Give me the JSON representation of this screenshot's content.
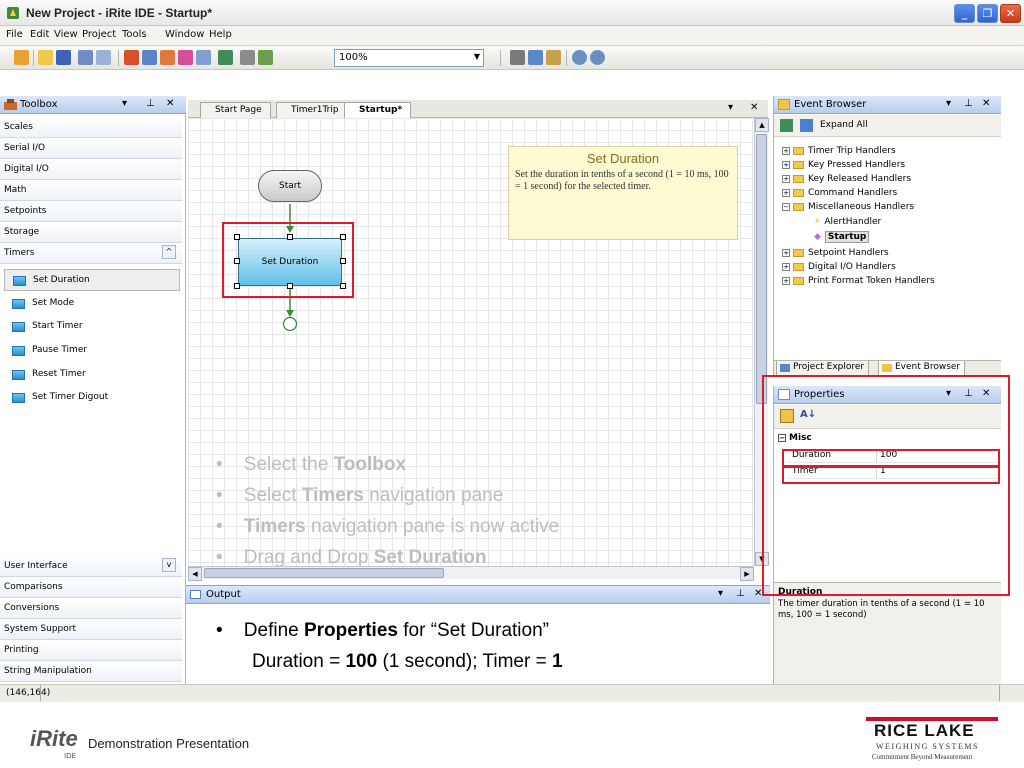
{
  "window": {
    "title": "New Project - iRite IDE - Startup*"
  },
  "menu": [
    "File",
    "Edit",
    "View",
    "Project",
    "Tools",
    "Window",
    "Help"
  ],
  "toolbar": {
    "zoom": "100%"
  },
  "toolbox": {
    "title": "Toolbox",
    "categories_top": [
      "Scales",
      "Serial I/O",
      "Digital I/O",
      "Math",
      "Setpoints",
      "Storage"
    ],
    "active_category": "Timers",
    "items": [
      "Set Duration",
      "Set Mode",
      "Start Timer",
      "Pause Timer",
      "Reset Timer",
      "Set Timer Digout"
    ],
    "categories_bottom": [
      "User Interface",
      "Comparisons",
      "Conversions",
      "System Support",
      "Printing",
      "String Manipulation"
    ]
  },
  "doc_tabs": [
    "Start Page",
    "Timer1Trip",
    "Startup*"
  ],
  "canvas": {
    "start_node": "Start",
    "selected_node": "Set Duration",
    "tooltip_title": "Set Duration",
    "tooltip_body": "Set the duration in tenths of a second (1 = 10 ms, 100 = 1 second) for the selected timer."
  },
  "overlay_bullets": [
    {
      "pre": "Select the ",
      "bold": "Toolbox",
      "post": ""
    },
    {
      "pre": "Select ",
      "bold": "Timers",
      "post": " navigation pane"
    },
    {
      "pre": "",
      "bold": "Timers",
      "post": " navigation pane is now active"
    },
    {
      "pre": "Drag and Drop ",
      "bold": "Set Duration",
      "post": ""
    }
  ],
  "output": {
    "title": "Output",
    "line1_pre": "Define ",
    "line1_bold": "Properties",
    "line1_post": " for “Set Duration”",
    "line2_pre": "Duration = ",
    "line2_bold1": "100",
    "line2_mid": " (1 second);  Timer = ",
    "line2_bold2": "1"
  },
  "event_browser": {
    "title": "Event Browser",
    "expand_all": "Expand All",
    "tree": [
      {
        "label": "Timer Trip Handlers",
        "level": 0,
        "type": "folder",
        "state": "+"
      },
      {
        "label": "Key Pressed Handlers",
        "level": 0,
        "type": "folder",
        "state": "+"
      },
      {
        "label": "Key Released Handlers",
        "level": 0,
        "type": "folder",
        "state": "+"
      },
      {
        "label": "Command Handlers",
        "level": 0,
        "type": "folder",
        "state": "+"
      },
      {
        "label": "Miscellaneous Handlers",
        "level": 0,
        "type": "folder",
        "state": "-"
      },
      {
        "label": "AlertHandler",
        "level": 1,
        "type": "handler",
        "state": ""
      },
      {
        "label": "Startup",
        "level": 1,
        "type": "handler-selected",
        "state": ""
      },
      {
        "label": "Setpoint Handlers",
        "level": 0,
        "type": "folder",
        "state": "+"
      },
      {
        "label": "Digital I/O Handlers",
        "level": 0,
        "type": "folder",
        "state": "+"
      },
      {
        "label": "Print Format Token Handlers",
        "level": 0,
        "type": "folder",
        "state": "+"
      }
    ],
    "tabs": [
      "Project Explorer",
      "Event Browser"
    ]
  },
  "properties": {
    "title": "Properties",
    "section": "Misc",
    "rows": [
      {
        "name": "Duration",
        "value": "100"
      },
      {
        "name": "Timer",
        "value": "1"
      }
    ],
    "desc_title": "Duration",
    "desc_body": "The timer duration in tenths of a second (1 = 10 ms, 100 = 1 second)"
  },
  "status": {
    "coords": "(146,164)"
  },
  "footer": {
    "logo_text": "iRite",
    "logo_sub": "IDE",
    "caption": "Demonstration Presentation",
    "company": "RICE LAKE",
    "company_sub": "WEIGHING SYSTEMS",
    "tagline": "Commitment Beyond Measurement"
  },
  "colors": {
    "highlight_red": "#d81e2c",
    "accent_blue": "#2b8ed1"
  }
}
